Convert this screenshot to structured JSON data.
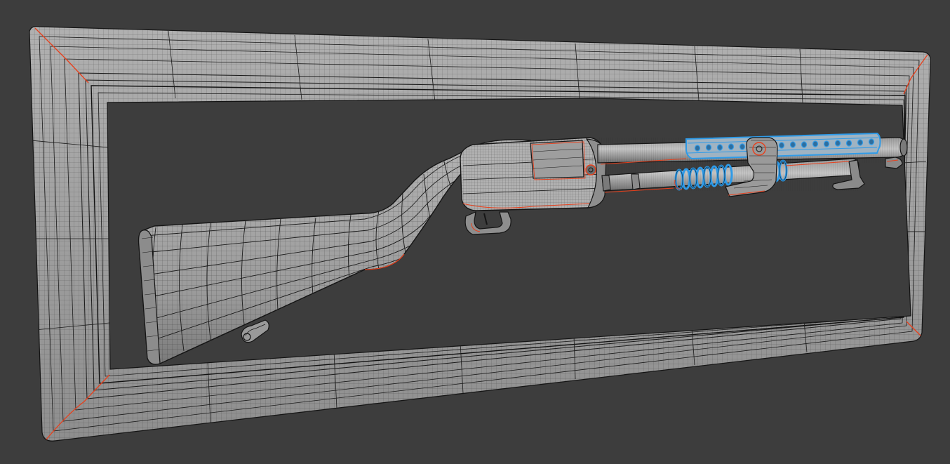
{
  "viewport": {
    "background_color": "#3d3d3d",
    "mesh_fill_color": "#a6a6a6",
    "mesh_fill_dark_color": "#7e7e7e",
    "wire_color": "#1a1a1a",
    "seam_color": "#e8401c",
    "selection_color": "#2f9be8",
    "shading_mode": "wireframe-over-solid"
  },
  "scene": {
    "objects": [
      {
        "name": "frame",
        "kind": "mesh"
      },
      {
        "name": "shotgun-stock",
        "kind": "mesh"
      },
      {
        "name": "shotgun-receiver",
        "kind": "mesh"
      },
      {
        "name": "shotgun-barrel",
        "kind": "mesh"
      },
      {
        "name": "heat-shield",
        "kind": "mesh",
        "selected": true
      },
      {
        "name": "magazine-spring",
        "kind": "mesh",
        "selected": true
      },
      {
        "name": "trigger-guard",
        "kind": "mesh"
      },
      {
        "name": "sling-swivel",
        "kind": "mesh"
      },
      {
        "name": "bayonet-lug",
        "kind": "mesh"
      }
    ]
  }
}
